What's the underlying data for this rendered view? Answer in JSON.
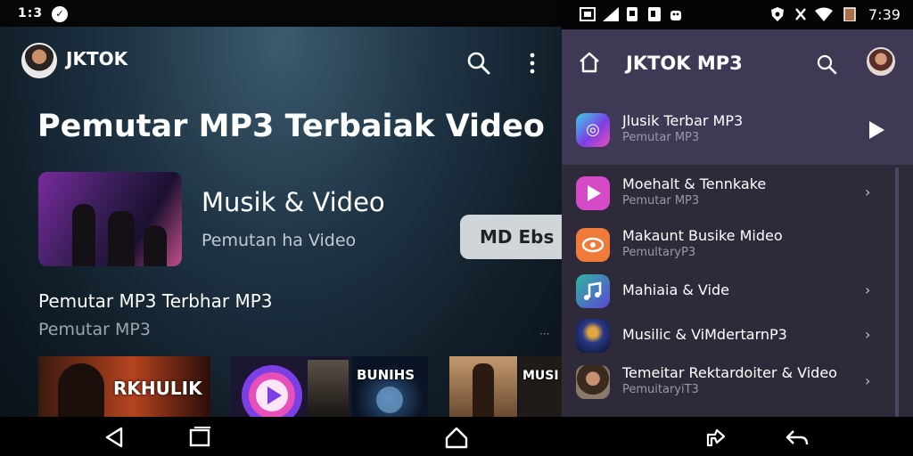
{
  "left_status": {
    "time": "1:3",
    "icon_glyph": "✓"
  },
  "left_header": {
    "app_name": "JKTOK"
  },
  "hero": {
    "title": "Pemutar MP3 Terbaiak Video"
  },
  "feature": {
    "title": "Musik & Video",
    "subtitle": "Pemutan ha Video"
  },
  "pill": {
    "label": "MD  Ebs"
  },
  "section": {
    "title": "Pemutar MP3 Terbhar MP3",
    "subtitle": "Pemutar MP3",
    "more": "···"
  },
  "tiles": [
    {
      "label": "RKHULIK"
    },
    {
      "label": ""
    },
    {
      "label": "BUNIHS"
    },
    {
      "label": "MUSI"
    }
  ],
  "right_status": {
    "time": "7:39"
  },
  "right_header": {
    "app_name": "JKTOK MP3"
  },
  "songs": [
    {
      "title": "Jlusik Terbar MP3",
      "subtitle": "Pemutar MP3",
      "icon": "music-app-icon",
      "color": "#7b3fe4"
    },
    {
      "title": "Moehalt & Tennkake",
      "subtitle": "Pemutar MP3",
      "icon": "play-app-icon",
      "color": "#d54ac7"
    },
    {
      "title": "Makaunt Busike Mideo",
      "subtitle": "PemultaryP3",
      "icon": "eye-app-icon",
      "color": "#f07a3a"
    },
    {
      "title": "Mahiaia & Vide",
      "subtitle": "",
      "icon": "music-note-app-icon",
      "color": "#5b46d6"
    },
    {
      "title": "Musilic & ViMdertarnP3",
      "subtitle": "",
      "icon": "album-art-icon",
      "color": "#2a3a86"
    },
    {
      "title": "Temeitar Rektardoiter & Video",
      "subtitle": "PemuitaryiT3",
      "icon": "artist-photo-icon",
      "color": "#5a4a3a"
    }
  ],
  "colors": {
    "right_header": "#403955",
    "right_panel": "#2e2a39",
    "pill": "#cfd5d8"
  }
}
